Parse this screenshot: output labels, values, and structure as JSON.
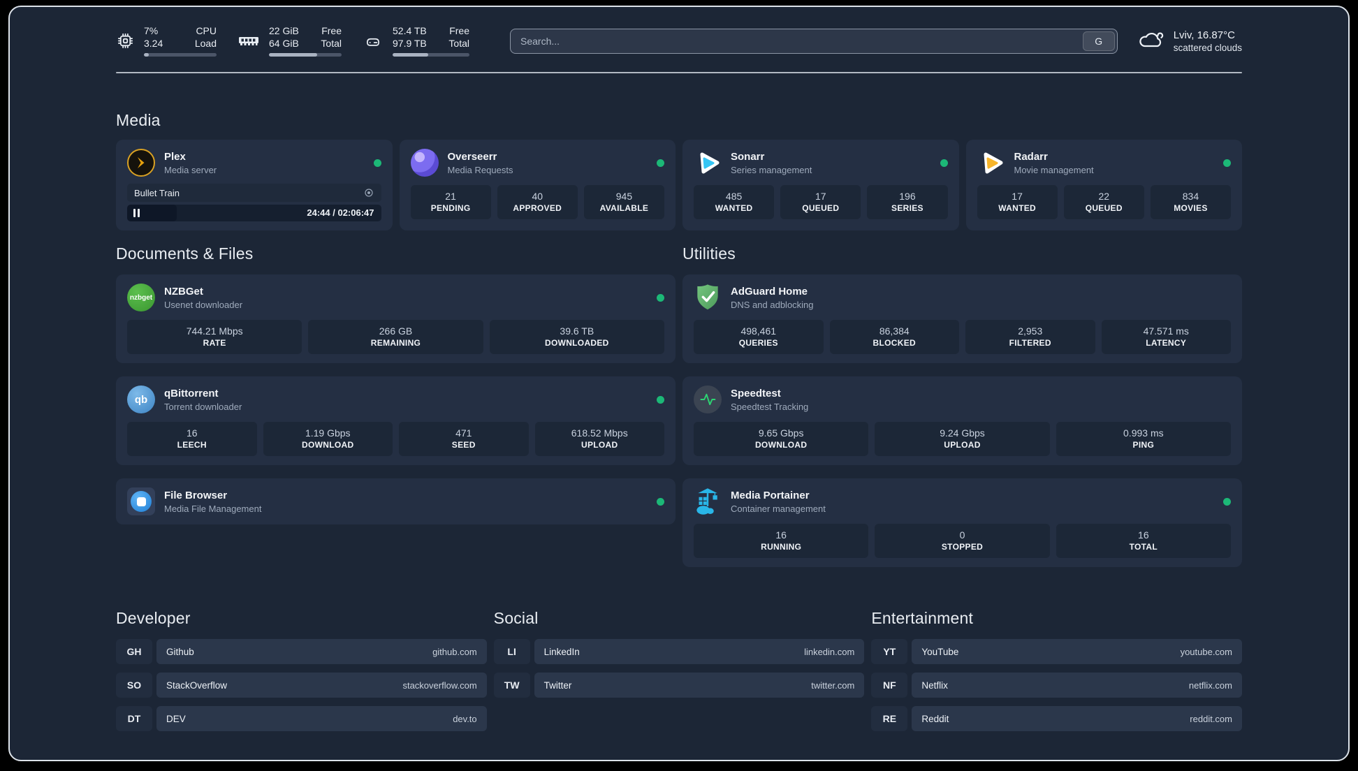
{
  "header": {
    "cpu": {
      "icon": "cpu-icon",
      "col1": [
        "7%",
        "3.24"
      ],
      "col2": [
        "CPU",
        "Load"
      ],
      "progress_pct": 7
    },
    "memory": {
      "icon": "ram-icon",
      "col1": [
        "22 GiB",
        "64 GiB"
      ],
      "col2": [
        "Free",
        "Total"
      ],
      "progress_pct": 66
    },
    "disk": {
      "icon": "disk-icon",
      "col1": [
        "52.4 TB",
        "97.9 TB"
      ],
      "col2": [
        "Free",
        "Total"
      ],
      "progress_pct": 46
    },
    "search": {
      "placeholder": "Search...",
      "button_label": "G"
    },
    "weather": {
      "icon": "cloud-icon",
      "line1": "Lviv, 16.87°C",
      "line2": "scattered clouds"
    }
  },
  "sections": {
    "media": {
      "title": "Media",
      "cards": {
        "plex": {
          "name": "Plex",
          "desc": "Media server",
          "status": "online",
          "session": {
            "title": "Bullet Train",
            "time": "24:44 / 02:06:47",
            "progress_pct": 19.5
          }
        },
        "overseerr": {
          "name": "Overseerr",
          "desc": "Media Requests",
          "status": "online",
          "stats": [
            {
              "value": "21",
              "label": "PENDING"
            },
            {
              "value": "40",
              "label": "APPROVED"
            },
            {
              "value": "945",
              "label": "AVAILABLE"
            }
          ]
        },
        "sonarr": {
          "name": "Sonarr",
          "desc": "Series management",
          "status": "online",
          "stats": [
            {
              "value": "485",
              "label": "WANTED"
            },
            {
              "value": "17",
              "label": "QUEUED"
            },
            {
              "value": "196",
              "label": "SERIES"
            }
          ]
        },
        "radarr": {
          "name": "Radarr",
          "desc": "Movie management",
          "status": "online",
          "stats": [
            {
              "value": "17",
              "label": "WANTED"
            },
            {
              "value": "22",
              "label": "QUEUED"
            },
            {
              "value": "834",
              "label": "MOVIES"
            }
          ]
        }
      }
    },
    "documents": {
      "title": "Documents & Files",
      "cards": {
        "nzbget": {
          "name": "NZBGet",
          "desc": "Usenet downloader",
          "status": "online",
          "icon_label": "nzbget",
          "stats": [
            {
              "value": "744.21 Mbps",
              "label": "RATE"
            },
            {
              "value": "266 GB",
              "label": "REMAINING"
            },
            {
              "value": "39.6 TB",
              "label": "DOWNLOADED"
            }
          ]
        },
        "qbittorrent": {
          "name": "qBittorrent",
          "desc": "Torrent downloader",
          "status": "online",
          "icon_label": "qb",
          "stats": [
            {
              "value": "16",
              "label": "LEECH"
            },
            {
              "value": "1.19 Gbps",
              "label": "DOWNLOAD"
            },
            {
              "value": "471",
              "label": "SEED"
            },
            {
              "value": "618.52 Mbps",
              "label": "UPLOAD"
            }
          ]
        },
        "filebrowser": {
          "name": "File Browser",
          "desc": "Media File Management",
          "status": "online"
        }
      }
    },
    "utilities": {
      "title": "Utilities",
      "cards": {
        "adguard": {
          "name": "AdGuard Home",
          "desc": "DNS and adblocking",
          "stats": [
            {
              "value": "498,461",
              "label": "QUERIES"
            },
            {
              "value": "86,384",
              "label": "BLOCKED"
            },
            {
              "value": "2,953",
              "label": "FILTERED"
            },
            {
              "value": "47.571 ms",
              "label": "LATENCY"
            }
          ]
        },
        "speedtest": {
          "name": "Speedtest",
          "desc": "Speedtest Tracking",
          "stats": [
            {
              "value": "9.65 Gbps",
              "label": "DOWNLOAD"
            },
            {
              "value": "9.24 Gbps",
              "label": "UPLOAD"
            },
            {
              "value": "0.993 ms",
              "label": "PING"
            }
          ]
        },
        "portainer": {
          "name": "Media Portainer",
          "desc": "Container management",
          "status": "online",
          "stats": [
            {
              "value": "16",
              "label": "RUNNING"
            },
            {
              "value": "0",
              "label": "STOPPED"
            },
            {
              "value": "16",
              "label": "TOTAL"
            }
          ]
        }
      }
    }
  },
  "bookmarks": {
    "developer": {
      "title": "Developer",
      "links": [
        {
          "abbr": "GH",
          "name": "Github",
          "url": "github.com"
        },
        {
          "abbr": "SO",
          "name": "StackOverflow",
          "url": "stackoverflow.com"
        },
        {
          "abbr": "DT",
          "name": "DEV",
          "url": "dev.to"
        }
      ]
    },
    "social": {
      "title": "Social",
      "links": [
        {
          "abbr": "LI",
          "name": "LinkedIn",
          "url": "linkedin.com"
        },
        {
          "abbr": "TW",
          "name": "Twitter",
          "url": "twitter.com"
        }
      ]
    },
    "entertainment": {
      "title": "Entertainment",
      "links": [
        {
          "abbr": "YT",
          "name": "YouTube",
          "url": "youtube.com"
        },
        {
          "abbr": "NF",
          "name": "Netflix",
          "url": "netflix.com"
        },
        {
          "abbr": "RE",
          "name": "Reddit",
          "url": "reddit.com"
        }
      ]
    }
  },
  "colors": {
    "status_online": "#1cb877",
    "plex_gold": "#e5a00d",
    "overseerr_purple": "#8b7cf7",
    "sonarr_blue": "#35c5f4",
    "radarr_orange": "#f7b52c",
    "nzbget_green": "#41a33c",
    "qbittorrent_blue": "#4f94d0",
    "adguard_green": "#67b279",
    "speedtest_pulse": "#2dd573",
    "portainer_blue": "#29b6e8",
    "filebrowser_blue": "#2d9cf0"
  }
}
